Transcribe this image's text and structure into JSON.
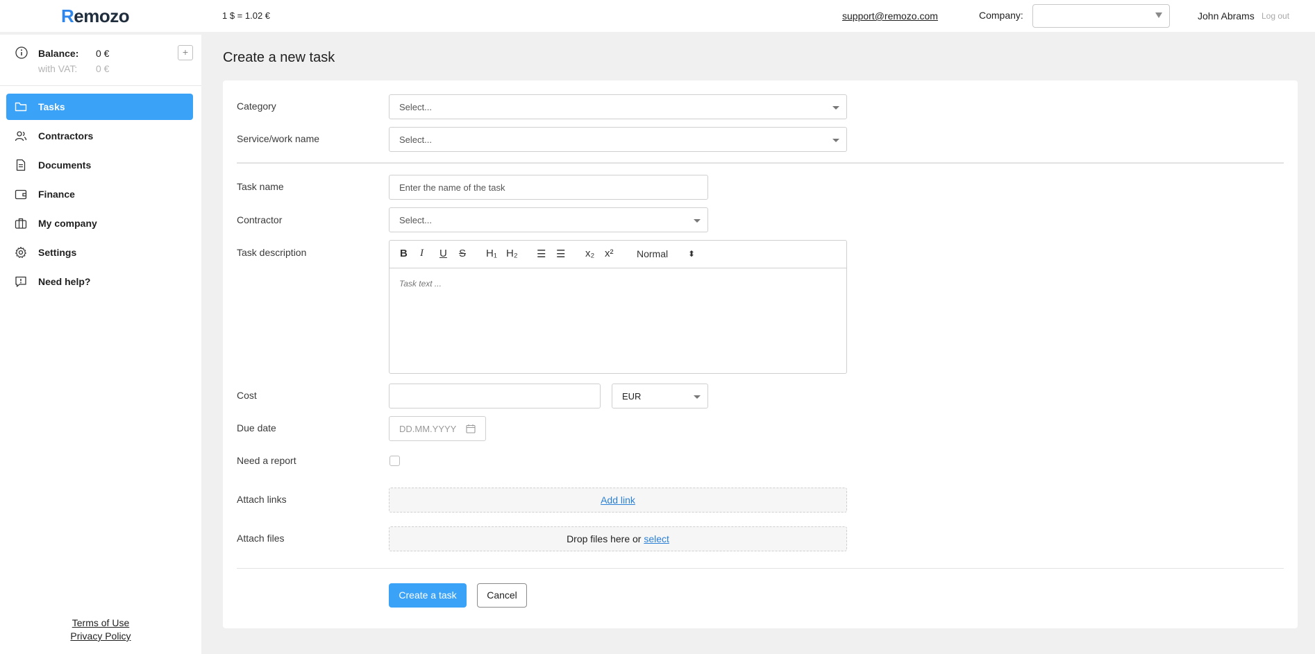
{
  "header": {
    "logo_first": "R",
    "logo_rest": "emozo",
    "rate": "1 $ = 1.02 €",
    "support_email": "support@remozo.com",
    "company_label": "Company:",
    "company_value": "",
    "user_name": "John Abrams",
    "logout": "Log out"
  },
  "sidebar": {
    "balance_label": "Balance:",
    "balance_value": "0 €",
    "vat_label": "with VAT:",
    "vat_value": "0 €",
    "add_symbol": "+",
    "items": [
      {
        "label": "Tasks",
        "icon": "folder-icon",
        "active": true
      },
      {
        "label": "Contractors",
        "icon": "users-icon",
        "active": false
      },
      {
        "label": "Documents",
        "icon": "document-icon",
        "active": false
      },
      {
        "label": "Finance",
        "icon": "wallet-icon",
        "active": false
      },
      {
        "label": "My company",
        "icon": "briefcase-icon",
        "active": false
      },
      {
        "label": "Settings",
        "icon": "gear-icon",
        "active": false
      },
      {
        "label": "Need help?",
        "icon": "help-chat-icon",
        "active": false
      }
    ],
    "terms": "Terms of Use",
    "privacy": "Privacy Policy"
  },
  "main": {
    "title": "Create a new task",
    "category_label": "Category",
    "category_placeholder": "Select...",
    "service_label": "Service/work name",
    "service_placeholder": "Select...",
    "task_name_label": "Task name",
    "task_name_placeholder": "Enter the name of the task",
    "contractor_label": "Contractor",
    "contractor_placeholder": "Select...",
    "description_label": "Task description",
    "toolbar": {
      "bold": "B",
      "italic": "I",
      "underline": "U",
      "strike": "S",
      "h1": "H₁",
      "h2": "H₂",
      "ordered_list": "☰",
      "bullet_list": "☰",
      "subscript": "x₂",
      "superscript": "x²",
      "format": "Normal",
      "format_arrows": "⬍"
    },
    "description_placeholder": "Task text ...",
    "cost_label": "Cost",
    "cost_value": "",
    "currency": "EUR",
    "due_date_label": "Due date",
    "due_date_placeholder": "DD.MM.YYYY",
    "report_label": "Need a report",
    "links_label": "Attach links",
    "add_link": "Add link",
    "files_label": "Attach files",
    "drop_text": "Drop files here or",
    "select_text": "select",
    "create_button": "Create a task",
    "cancel_button": "Cancel"
  },
  "colors": {
    "accent": "#3aa2f7",
    "link": "#2a7fd6",
    "background": "#f0f0f0"
  }
}
